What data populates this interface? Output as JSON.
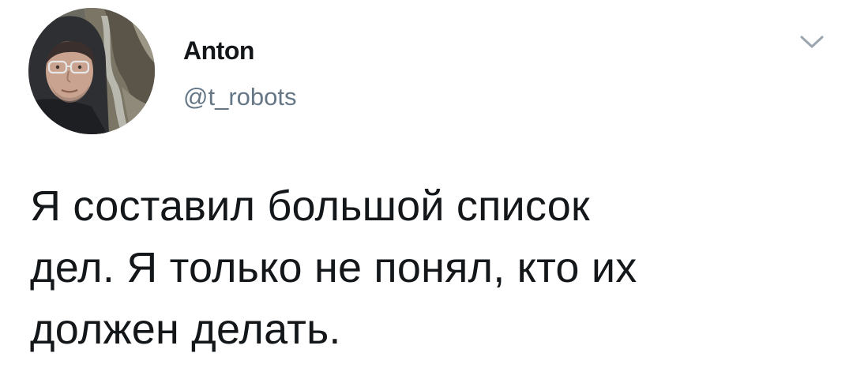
{
  "author": {
    "name": "Anton",
    "handle": "@t_robots",
    "avatar_icon": "user-avatar-photo"
  },
  "menu": {
    "icon": "chevron-down-icon"
  },
  "tweet": {
    "text": "Я составил большой список\nдел. Я только не понял, кто их\nдолжен делать."
  },
  "colors": {
    "text_primary": "#14171a",
    "text_secondary": "#657786",
    "caret": "#9aa5af",
    "background": "#ffffff"
  }
}
